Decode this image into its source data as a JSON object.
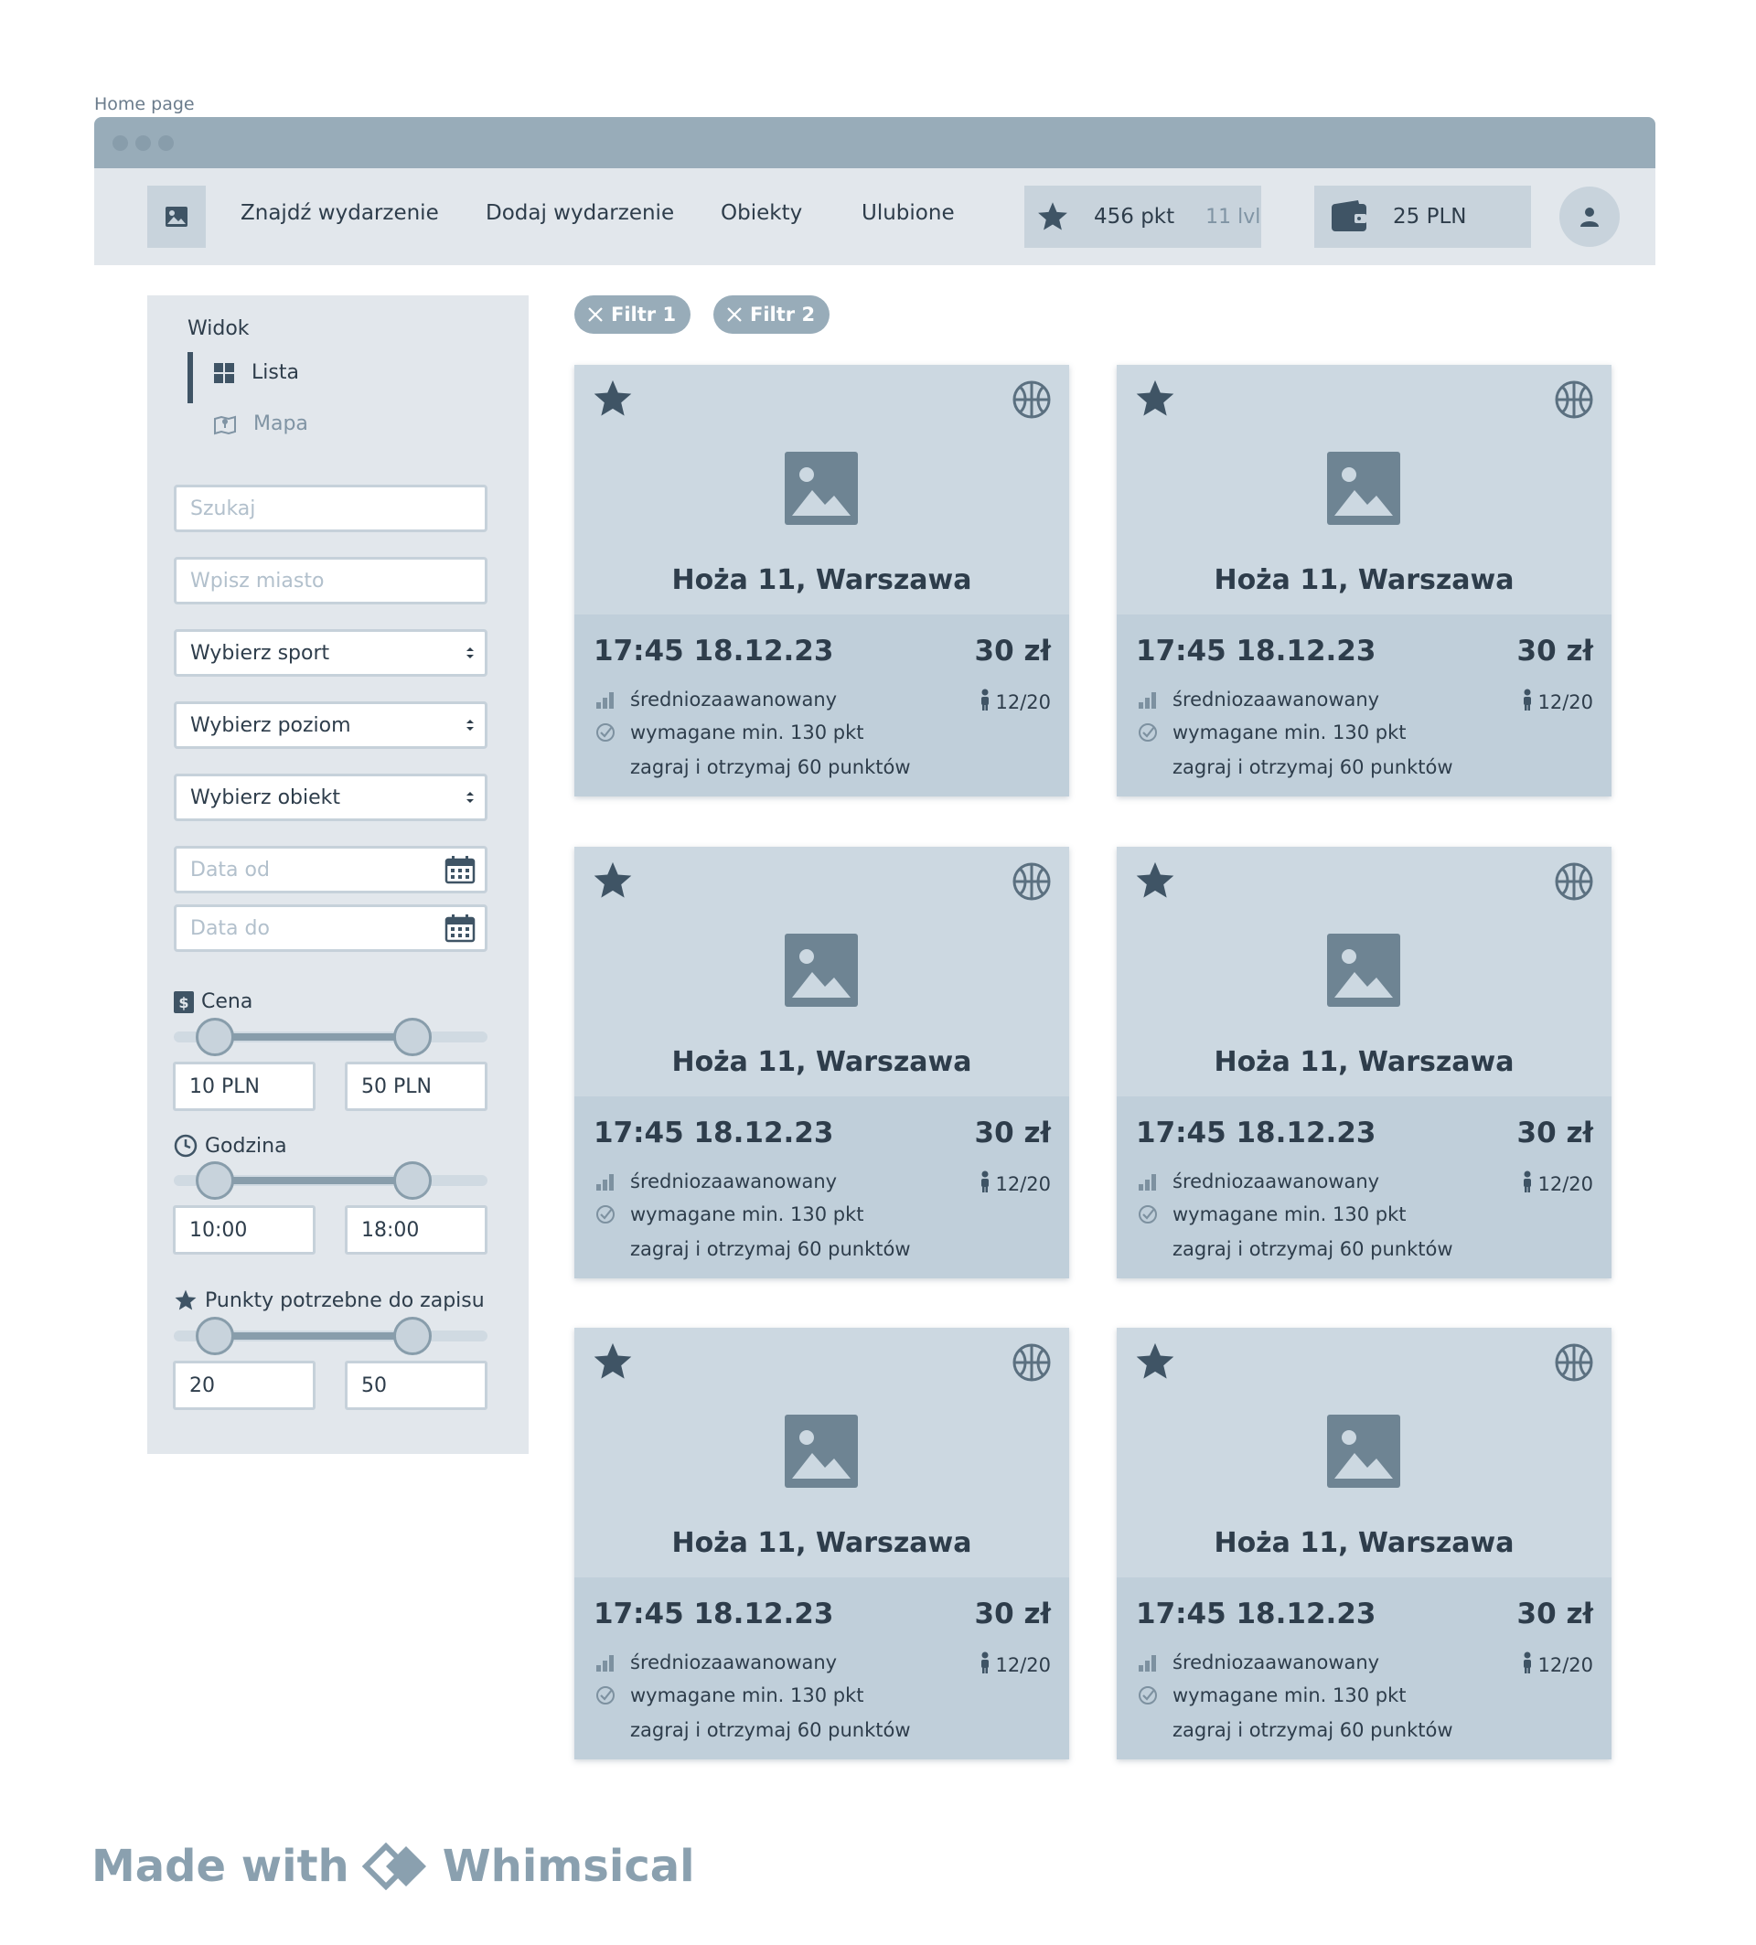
{
  "caption": "Home page",
  "nav": {
    "links": [
      "Znajdź wydarzenie",
      "Dodaj wydarzenie",
      "Obiekty",
      "Ulubione"
    ],
    "points": "456 pkt",
    "level": "11 lvl",
    "wallet": "25 PLN",
    "icons": {
      "logo": "image-icon",
      "points": "star-icon",
      "wallet": "wallet-icon",
      "avatar": "user-icon"
    }
  },
  "sidebar": {
    "view_title": "Widok",
    "view_list": "Lista",
    "view_map": "Mapa",
    "search_placeholder": "Szukaj",
    "city_placeholder": "Wpisz miasto",
    "sport_select": "Wybierz sport",
    "level_select": "Wybierz poziom",
    "venue_select": "Wybierz obiekt",
    "date_from_placeholder": "Data od",
    "date_to_placeholder": "Data do",
    "price": {
      "label": "Cena",
      "min": "10 PLN",
      "max": "50 PLN"
    },
    "hour": {
      "label": "Godzina",
      "min": "10:00",
      "max": "18:00"
    },
    "points": {
      "label": "Punkty potrzebne do zapisu",
      "min": "20",
      "max": "50"
    }
  },
  "filters": [
    "Filtr 1",
    "Filtr 2"
  ],
  "cards": [
    {
      "address": "Hoża 11, Warszawa",
      "datetime": "17:45 18.12.23",
      "price": "30 zł",
      "level": "średniozaawanowany",
      "slots": "12/20",
      "requirement": "wymagane min. 130 pkt",
      "reward": "zagraj i otrzymaj 60 punktów"
    },
    {
      "address": "Hoża 11, Warszawa",
      "datetime": "17:45 18.12.23",
      "price": "30 zł",
      "level": "średniozaawanowany",
      "slots": "12/20",
      "requirement": "wymagane min. 130 pkt",
      "reward": "zagraj i otrzymaj 60 punktów"
    },
    {
      "address": "Hoża 11, Warszawa",
      "datetime": "17:45 18.12.23",
      "price": "30 zł",
      "level": "średniozaawanowany",
      "slots": "12/20",
      "requirement": "wymagane min. 130 pkt",
      "reward": "zagraj i otrzymaj 60 punktów"
    },
    {
      "address": "Hoża 11, Warszawa",
      "datetime": "17:45 18.12.23",
      "price": "30 zł",
      "level": "średniozaawanowany",
      "slots": "12/20",
      "requirement": "wymagane min. 130 pkt",
      "reward": "zagraj i otrzymaj 60 punktów"
    },
    {
      "address": "Hoża 11, Warszawa",
      "datetime": "17:45 18.12.23",
      "price": "30 zł",
      "level": "średniozaawanowany",
      "slots": "12/20",
      "requirement": "wymagane min. 130 pkt",
      "reward": "zagraj i otrzymaj 60 punktów"
    },
    {
      "address": "Hoża 11, Warszawa",
      "datetime": "17:45 18.12.23",
      "price": "30 zł",
      "level": "średniozaawanowany",
      "slots": "12/20",
      "requirement": "wymagane min. 130 pkt",
      "reward": "zagraj i otrzymaj 60 punktów"
    }
  ],
  "footer": {
    "made_with": "Made with",
    "brand": "Whimsical"
  },
  "colors": {
    "frame": "#98acb9",
    "panel": "#e2e7ec",
    "card": "#ccd8e1",
    "card_bottom": "#c0cfda",
    "icon_dark": "#3f5465",
    "text": "#2e3d4b"
  }
}
